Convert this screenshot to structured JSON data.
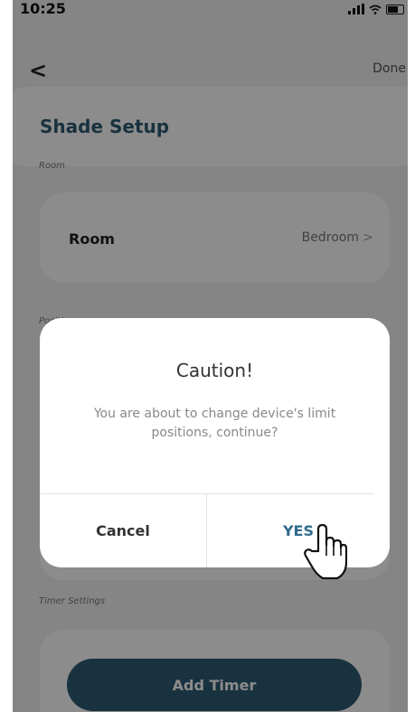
{
  "status_bar": {
    "time": "10:25"
  },
  "nav": {
    "back_icon": "chevron-left-icon",
    "back_glyph": "<",
    "done_label": "Done"
  },
  "page": {
    "title": "Shade Setup"
  },
  "room_section": {
    "label": "Room",
    "item_label": "Room",
    "item_value": "Bedroom",
    "chevron": ">"
  },
  "positions_section": {
    "label": "Positions"
  },
  "timer_section": {
    "label": "Timer Settings",
    "button_label": "Add Timer"
  },
  "dialog": {
    "title": "Caution!",
    "message": "You are about to change device's limit positions, continue?",
    "cancel_label": "Cancel",
    "confirm_label": "YES"
  },
  "colors": {
    "brand": "#2f5b73",
    "confirm": "#2f6b8c",
    "background": "#f3f3f3"
  },
  "cursor": {
    "icon": "hand-pointer-icon"
  }
}
